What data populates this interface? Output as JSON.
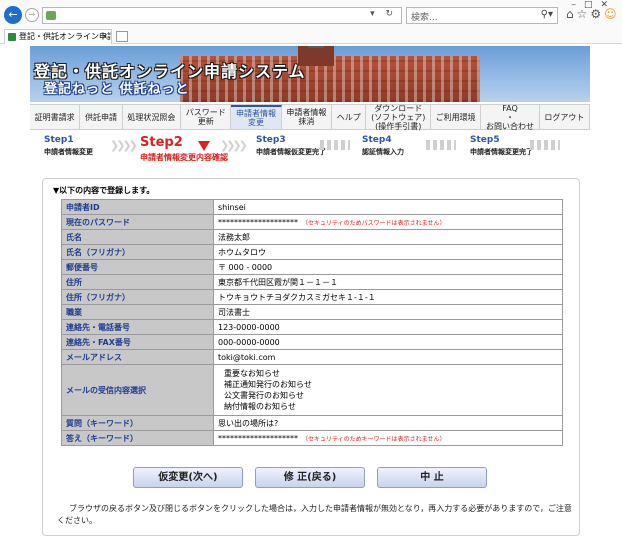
{
  "browser": {
    "search_placeholder": "検索...",
    "tab_title": "登記・供託オンライン申請シス..."
  },
  "banner": {
    "title": "登記・供託オンライン申請システム",
    "subtitle": "登記ねっと 供託ねっと"
  },
  "menu": [
    {
      "label": "証明書請求"
    },
    {
      "label": "供託申請"
    },
    {
      "label": "処理状況照会"
    },
    {
      "label": "パスワード\n更新"
    },
    {
      "label": "申請者情報\n変更",
      "active": true
    },
    {
      "label": "申請者情報\n抹消"
    },
    {
      "label": "ヘルプ"
    },
    {
      "label": "ダウンロード\n(ソフトウェア)\n(操作手引書)"
    },
    {
      "label": "ご利用環境"
    },
    {
      "label": "FAQ\n・\nお問い合わせ"
    },
    {
      "label": "ログアウト"
    }
  ],
  "steps": [
    {
      "label": "Step1",
      "desc": "申請者情報変更"
    },
    {
      "label": "Step2",
      "desc": "申請者情報変更内容確認"
    },
    {
      "label": "Step3",
      "desc": "申請者情報仮変更完了"
    },
    {
      "label": "Step4",
      "desc": "認証情報入力"
    },
    {
      "label": "Step5",
      "desc": "申請者情報変更完了"
    }
  ],
  "intro": "▼以下の内容で登録します。",
  "fields": {
    "applicant_id": {
      "label": "申請者ID",
      "value": "shinsei"
    },
    "current_password": {
      "label": "現在のパスワード",
      "value": "********************",
      "note": "（セキュリティのためパスワードは表示されません）"
    },
    "name": {
      "label": "氏名",
      "value": "法務太郎"
    },
    "name_kana": {
      "label": "氏名（フリガナ）",
      "value": "ホウムタロウ"
    },
    "postal_code": {
      "label": "郵便番号",
      "value": "〒 000 - 0000"
    },
    "address": {
      "label": "住所",
      "value": "東京都千代田区霞が関１－１－１"
    },
    "address_kana": {
      "label": "住所（フリガナ）",
      "value": "トウキョウトチヨダクカスミガセキ１-１-１"
    },
    "occupation": {
      "label": "職業",
      "value": "司法書士"
    },
    "phone": {
      "label": "連絡先・電話番号",
      "value": "123-0000-0000"
    },
    "fax": {
      "label": "連絡先・FAX番号",
      "value": "000-0000-0000"
    },
    "email": {
      "label": "メールアドレス",
      "value": "toki@toki.com"
    },
    "mail_subscription": {
      "label": "メールの受信内容選択",
      "items": [
        "重要なお知らせ",
        "補正通知発行のお知らせ",
        "公文書発行のお知らせ",
        "納付情報のお知らせ"
      ]
    },
    "question": {
      "label": "質問（キーワード）",
      "value": "思い出の場所は?"
    },
    "answer": {
      "label": "答え（キーワード）",
      "value": "********************",
      "note": "（セキュリティのためキーワードは表示されません）"
    }
  },
  "buttons": {
    "next": "仮変更(次へ)",
    "modify": "修 正(戻る)",
    "cancel": "中 止"
  },
  "footer_note": "ブラウザの戻るボタン及び閉じるボタンをクリックした場合は，入力した申請者情報が無効となり，再入力する必要がありますので，ご注意ください。"
}
